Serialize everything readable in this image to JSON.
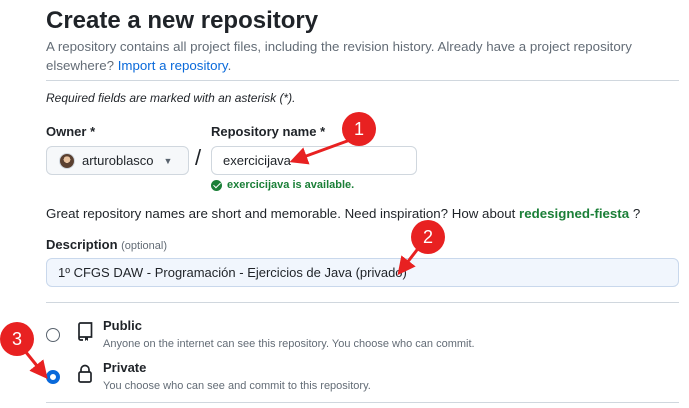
{
  "page": {
    "title": "Create a new repository",
    "subtitle_text": "A repository contains all project files, including the revision history. Already have a project repository elsewhere?",
    "subtitle_link": "Import a repository",
    "subtitle_end": "."
  },
  "form": {
    "required_note": "Required fields are marked with an asterisk (*).",
    "owner": {
      "label": "Owner *",
      "value": "arturoblasco"
    },
    "separator": "/",
    "repo_name": {
      "label": "Repository name *",
      "value": "exercicijava"
    },
    "availability": "exercicijava is available.",
    "inspiration_text": "Great repository names are short and memorable. Need inspiration? How about",
    "inspiration_suggestion": "redesigned-fiesta",
    "inspiration_end": " ?",
    "description": {
      "label": "Description",
      "optional": "(optional)",
      "value": "1º CFGS DAW - Programación - Ejercicios de Java (privado)"
    },
    "visibility": [
      {
        "title": "Public",
        "desc": "Anyone on the internet can see this repository. You choose who can commit.",
        "icon": "repo-icon",
        "selected": false
      },
      {
        "title": "Private",
        "desc": "You choose who can see and commit to this repository.",
        "icon": "lock-icon",
        "selected": true
      }
    ]
  },
  "annotations": [
    {
      "number": "1"
    },
    {
      "number": "2"
    },
    {
      "number": "3"
    }
  ],
  "colors": {
    "accent": "#0969da",
    "success": "#1a7f37",
    "annotation": "#e82121"
  }
}
